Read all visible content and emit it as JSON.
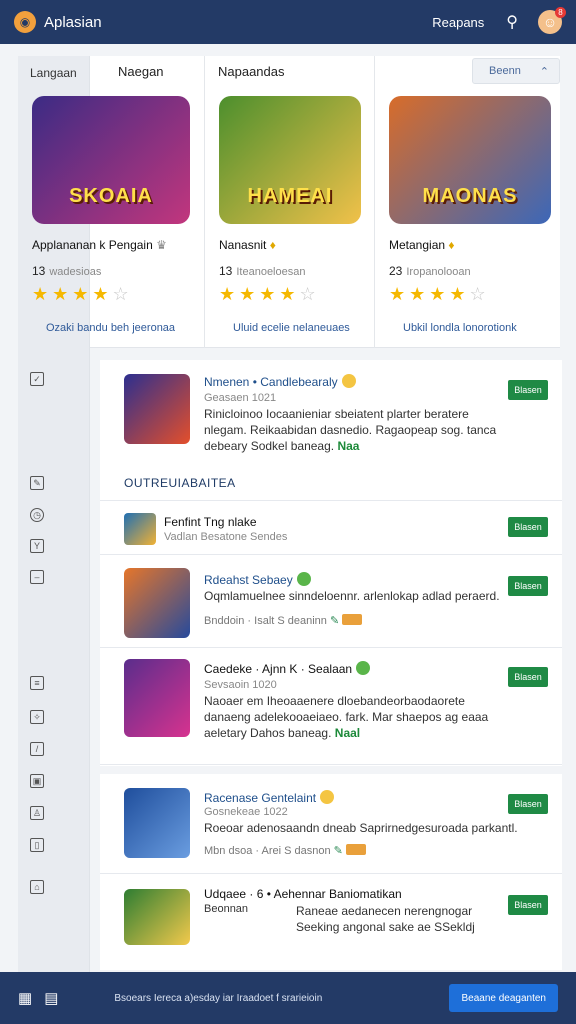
{
  "header": {
    "title": "Aplasian",
    "link": "Reapans",
    "notification_count": "8"
  },
  "leftstrip": {
    "tab_label": "Langaan"
  },
  "featured": {
    "tabs": [
      "Naegan",
      "Napaandas"
    ],
    "sort_label": "Beenn",
    "cards": [
      {
        "art": "SKOAIA",
        "name": "Applananan k Pengain",
        "count": "13",
        "sub": "wadesioas",
        "rating": 3.5,
        "link": "Ozaki bandu beh jeeronaa",
        "colors": [
          "#3b2b84",
          "#c2367d"
        ]
      },
      {
        "art": "HAMEAI",
        "name": "Nanasnit",
        "count": "13",
        "sub": "Iteanoeloesan",
        "rating": 4.5,
        "link": "Uluid ecelie nelaneuaes",
        "colors": [
          "#4c8f2d",
          "#f1c14a"
        ]
      },
      {
        "art": "MAONAS",
        "name": "Metangian",
        "count": "23",
        "sub": "Iropanolooan",
        "rating": 4.5,
        "link": "Ubkil londla lonorotionk",
        "colors": [
          "#d86c2a",
          "#3c67b8"
        ]
      }
    ]
  },
  "list": {
    "section_title": "OUTREUIABAITEA",
    "get_label": "Blasen",
    "items": [
      {
        "title": "Nmenen • Candlebearaly",
        "sub": "Geasaen 1021",
        "desc": "Rinicloinoo Iocaanieniar sbeiatent plarter beratere nlegam. Reikaabidan dasnedio. Ragaopeap sog. tanca debeary Sodkel baneag.",
        "highlight": "Naa",
        "colors": [
          "#2c2f8f",
          "#e44f2b"
        ]
      },
      {
        "title": "Fenfint Tng nlake",
        "sub": "Vadlan Besatone Sendes",
        "colors": [
          "#1f6fb3",
          "#f2b234"
        ]
      },
      {
        "title": "Rdeahst Sebaey",
        "desc": "Oqmlamuelnee sinndeloennr. arlenlokap adlad peraerd.",
        "meta": "Bnddoin · Isalt S deaninn",
        "colors": [
          "#e6762a",
          "#264a9c"
        ]
      },
      {
        "title": "Caedeke · Ajnn K · Sealaan",
        "sub": "Sevsaoin 1020",
        "desc": "Naoaer em Iheoaaenere dloebandeorbaodaorete danaeng adelekooaeiaeo. fark. Mar shaepos ag eaaa aeletary Dahos baneag.",
        "highlight": "Naal",
        "colors": [
          "#5a2d8c",
          "#d7338f"
        ]
      },
      {
        "title": "Racenase Gentelaint",
        "sub": "Gosnekeae 1022",
        "desc": "Roeoar adenosaandn dneab Saprirnedgesuroada parkantl.",
        "meta": "Mbn dsoa · Arei S dasnon",
        "colors": [
          "#1f4e9c",
          "#6a9de0"
        ]
      },
      {
        "title": "Udqaee · 6 • Aehennar Baniomatikan",
        "sub": "Beonnan",
        "desc": "Raneae aedanecen nerengnogar Seeking angonal sake ae SSekldj",
        "colors": [
          "#2e7d32",
          "#f2c94c"
        ]
      }
    ]
  },
  "bottombar": {
    "text": "Bsoears Iereca a)esday iar Iraadoet f srarieioin",
    "button": "Beaane deaganten"
  }
}
